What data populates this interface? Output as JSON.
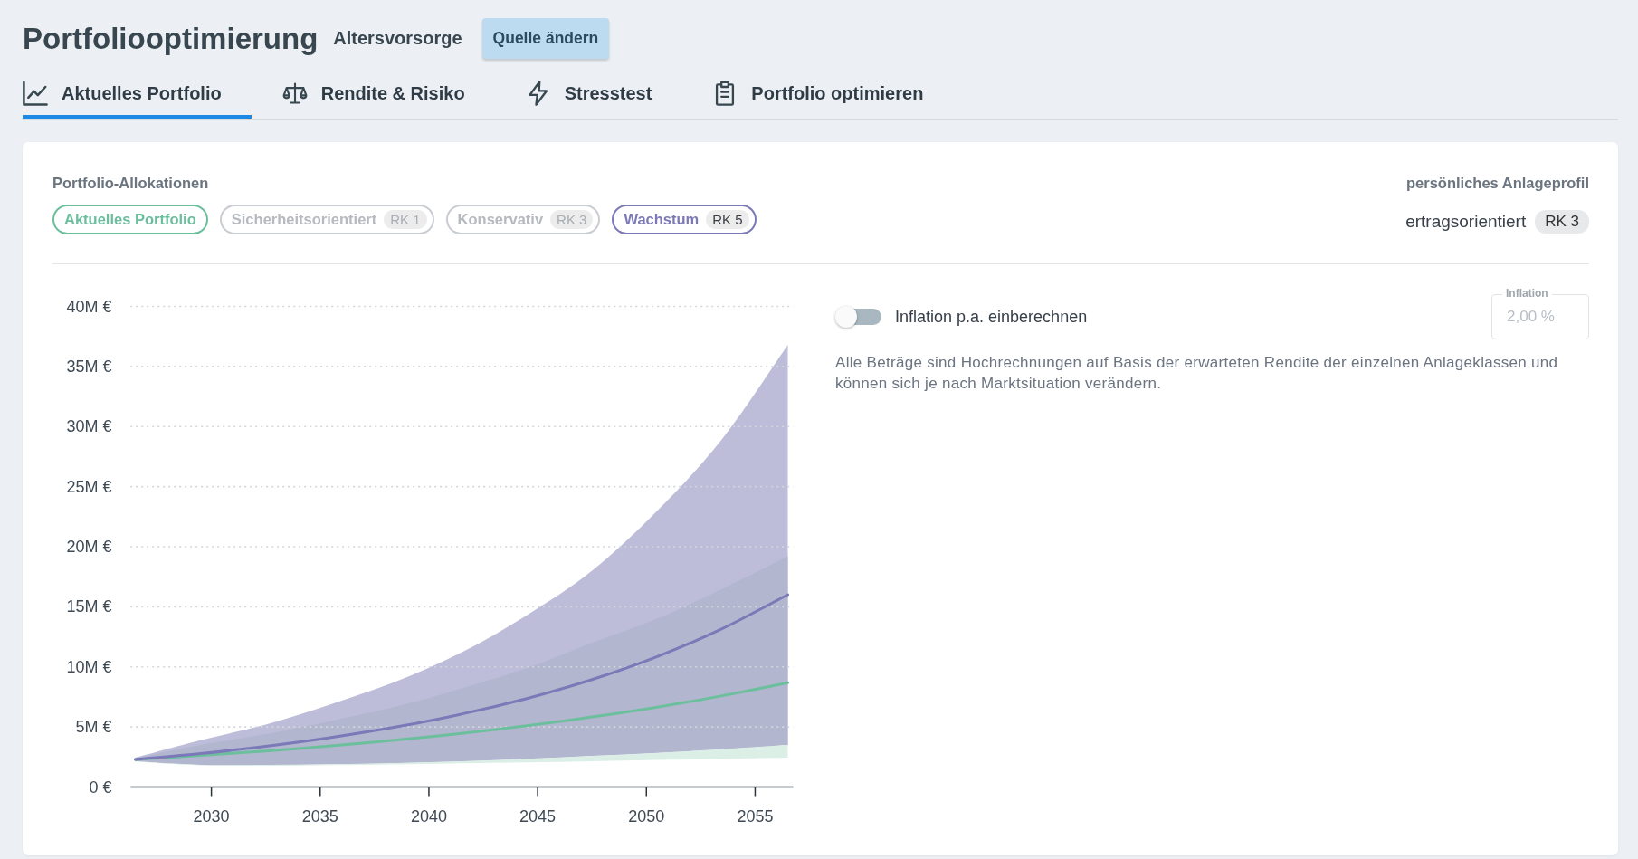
{
  "header": {
    "title": "Portfoliooptimierung",
    "subtitle": "Altersvorsorge",
    "button": "Quelle ändern"
  },
  "tabs": [
    {
      "label": "Aktuelles Portfolio",
      "selected": true
    },
    {
      "label": "Rendite & Risiko",
      "selected": false
    },
    {
      "label": "Stresstest",
      "selected": false
    },
    {
      "label": "Portfolio optimieren",
      "selected": false
    }
  ],
  "allocations": {
    "label": "Portfolio-Allokationen",
    "chips": [
      {
        "label": "Aktuelles Portfolio",
        "selected": true,
        "color": "#6cbf9c"
      },
      {
        "label": "Sicherheitsorientiert",
        "badge": "RK 1",
        "selected": false
      },
      {
        "label": "Konservativ",
        "badge": "RK 3",
        "selected": false
      },
      {
        "label": "Wachstum",
        "badge": "RK 5",
        "selected": true,
        "color": "#7b79b8"
      }
    ]
  },
  "profile": {
    "label": "persönliches Anlageprofil",
    "value": "ertragsorientiert",
    "badge": "RK 3"
  },
  "inflation": {
    "toggle_label": "Inflation p.a. einberechnen",
    "on": false,
    "field": {
      "label": "Inflation",
      "value": "2,00 %",
      "disabled": true
    }
  },
  "note": "Alle Beträge sind Hochrechnungen auf Basis der erwarteten Rendite der einzelnen Anlageklassen und können sich je nach Marktsituation verändern.",
  "chart_data": {
    "type": "line",
    "grid": true,
    "x": [
      2026.5,
      2029.5,
      2032.5,
      2035.5,
      2038.5,
      2041.5,
      2044.5,
      2047.5,
      2050.5,
      2053.5,
      2056.5
    ],
    "series": [
      {
        "color": "#6cbf9c",
        "values": [
          2.3,
          2.63,
          3.0,
          3.42,
          3.91,
          4.47,
          5.1,
          5.83,
          6.65,
          7.6,
          8.68
        ]
      },
      {
        "color": "#7b79b8",
        "values": [
          2.3,
          2.79,
          3.39,
          4.12,
          5.0,
          6.07,
          7.37,
          8.95,
          10.86,
          13.19,
          16.01
        ]
      }
    ],
    "xlim": [
      2026.28,
      2056.75
    ],
    "ylim": [
      0,
      40
    ],
    "xticks": [
      2030,
      2035,
      2040,
      2045,
      2050,
      2055
    ],
    "yticks": [
      {
        "value": 0,
        "label": "0 €"
      },
      {
        "value": 5,
        "label": "5M €"
      },
      {
        "value": 10,
        "label": "10M €"
      },
      {
        "value": 15,
        "label": "15M €"
      },
      {
        "value": 20,
        "label": "20M €"
      },
      {
        "value": 25,
        "label": "25M €"
      },
      {
        "value": 30,
        "label": "30M €"
      },
      {
        "value": 35,
        "label": "35M €"
      },
      {
        "value": 40,
        "label": "40M €"
      }
    ]
  }
}
